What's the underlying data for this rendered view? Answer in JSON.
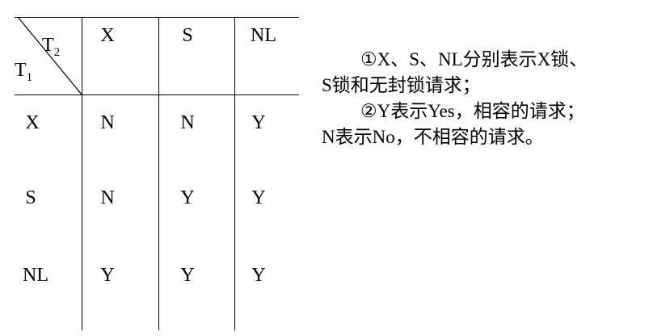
{
  "matrix": {
    "corner_row_label": "T",
    "corner_row_sub": "1",
    "corner_col_label": "T",
    "corner_col_sub": "2",
    "col_headers": [
      "X",
      "S",
      "NL"
    ],
    "rows": [
      {
        "header": "X",
        "cells": [
          "N",
          "N",
          "Y"
        ]
      },
      {
        "header": "S",
        "cells": [
          "N",
          "Y",
          "Y"
        ]
      },
      {
        "header": "NL",
        "cells": [
          "Y",
          "Y",
          "Y"
        ]
      }
    ]
  },
  "notes": {
    "line1": "①X、S、NL分别表示X锁、",
    "line2": "S锁和无封锁请求；",
    "line3": "②Y表示Yes，相容的请求；",
    "line4": "N表示No，不相容的请求。"
  }
}
